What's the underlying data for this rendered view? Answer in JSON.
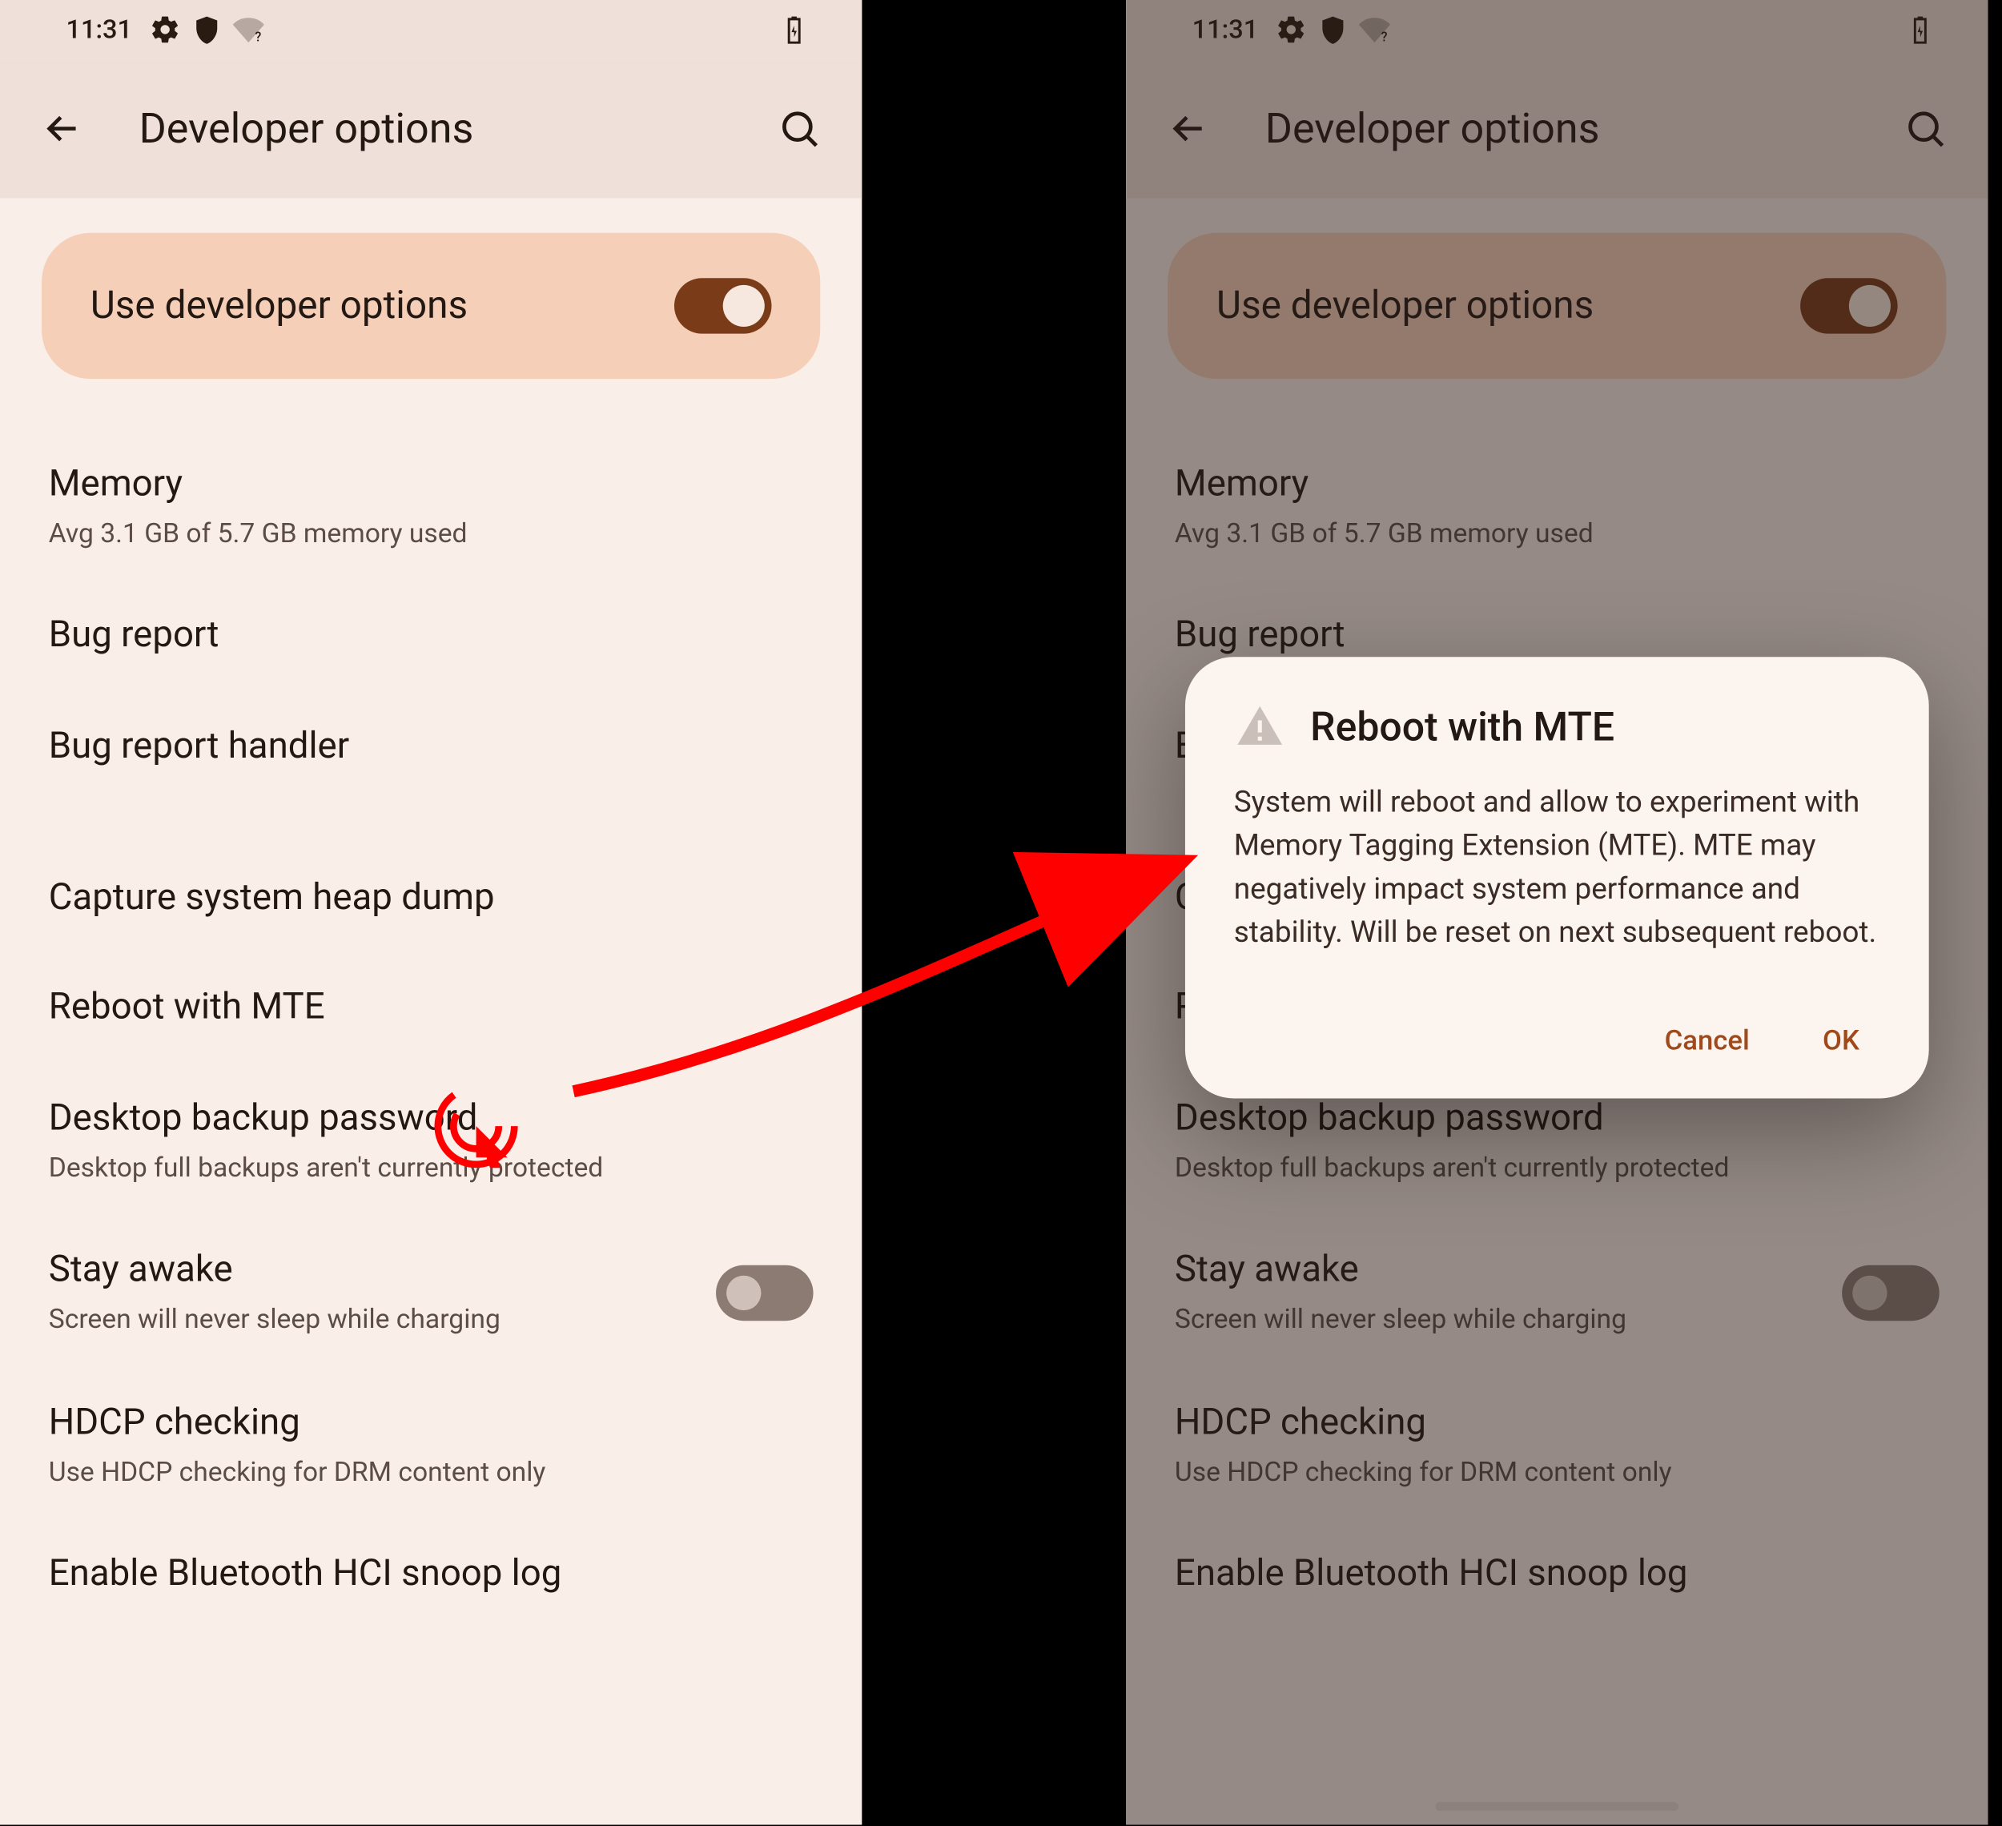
{
  "statusbar": {
    "time": "11:31"
  },
  "appbar": {
    "title": "Developer options"
  },
  "masterToggle": {
    "label": "Use developer options"
  },
  "items": {
    "memory": {
      "primary": "Memory",
      "secondary": "Avg 3.1 GB of 5.7 GB memory used"
    },
    "bugreport": {
      "primary": "Bug report"
    },
    "bugreporthandler": {
      "primary": "Bug report handler"
    },
    "heapdump": {
      "primary": "Capture system heap dump"
    },
    "rebootmte": {
      "primary": "Reboot with MTE"
    },
    "desktopbackup": {
      "primary": "Desktop backup password",
      "secondary": "Desktop full backups aren't currently protected"
    },
    "stayawake": {
      "primary": "Stay awake",
      "secondary": "Screen will never sleep while charging"
    },
    "hdcp": {
      "primary": "HDCP checking",
      "secondary": "Use HDCP checking for DRM content only"
    },
    "btsnoop": {
      "primary": "Enable Bluetooth HCI snoop log"
    }
  },
  "dialog": {
    "title": "Reboot with MTE",
    "body": "System will reboot and allow to experiment with Memory Tagging Extension (MTE). MTE may negatively impact system performance and stability. Will be reset on next subsequent reboot.",
    "cancel": "Cancel",
    "ok": "OK"
  },
  "annotation": {
    "arrow_color": "#ff0000"
  }
}
